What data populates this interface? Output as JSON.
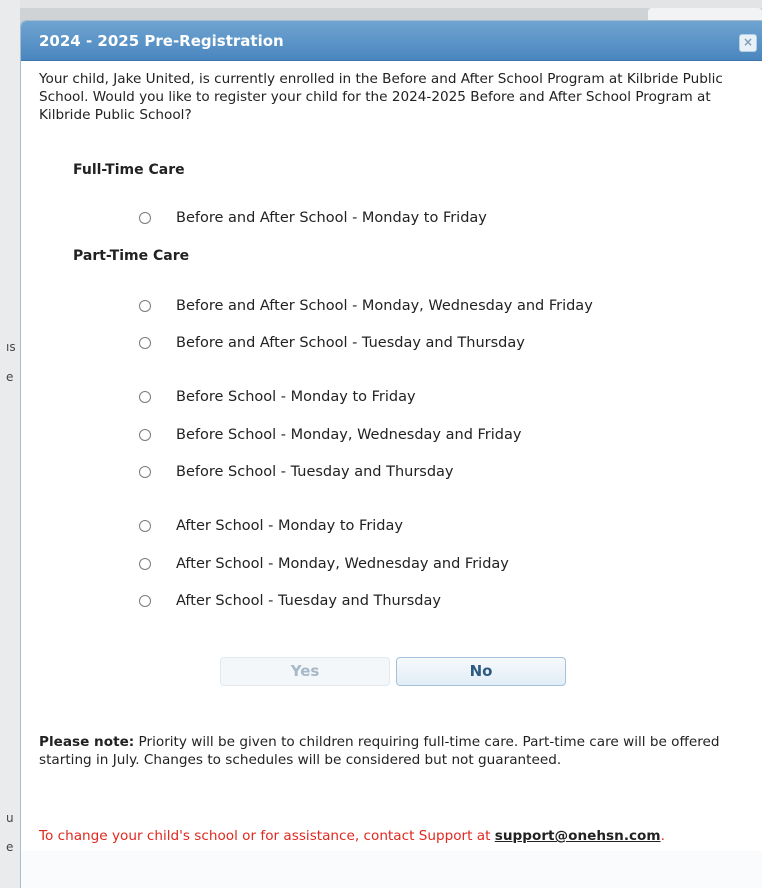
{
  "dialog": {
    "title": "2024 - 2025 Pre-Registration",
    "close_label": "×",
    "intro": "Your child, Jake United, is currently enrolled in the Before and After School Program at Kilbride Public School. Would you like to register your child for the 2024-2025 Before and After School Program at Kilbride Public School?"
  },
  "full_time": {
    "heading": "Full-Time Care",
    "options": [
      "Before and After School - Monday to Friday"
    ]
  },
  "part_time": {
    "heading": "Part-Time Care",
    "options": [
      "Before and After School - Monday, Wednesday and Friday",
      "Before and After School - Tuesday and Thursday",
      "Before School - Monday to Friday",
      "Before School - Monday, Wednesday and Friday",
      "Before School - Tuesday and Thursday",
      "After School - Monday to Friday",
      "After School - Monday, Wednesday and Friday",
      "After School - Tuesday and Thursday"
    ]
  },
  "buttons": {
    "yes": "Yes",
    "no": "No"
  },
  "note": {
    "label": "Please note:",
    "text": " Priority will be given to children requiring full-time care. Part-time care will be offered starting in July. Changes to schedules will be considered but not guaranteed."
  },
  "support": {
    "text": "To change your child's school or for assistance, contact Support at",
    "email": "support@onehsn.com",
    "period": "."
  },
  "background": {
    "fragments": [
      "ıs",
      "e",
      "u",
      "e"
    ]
  },
  "colors": {
    "titlebar": "#4a86bf",
    "support_text": "#e0281f",
    "no_button_text": "#2f5a82"
  }
}
